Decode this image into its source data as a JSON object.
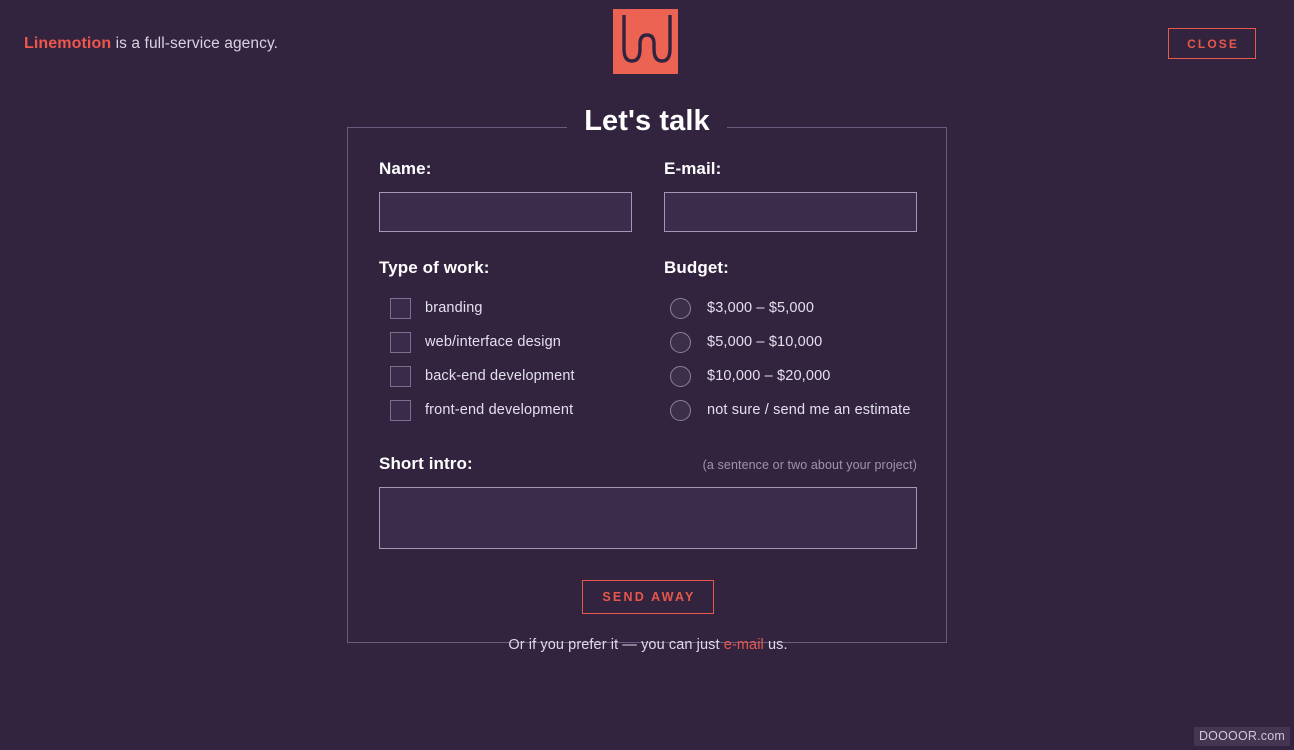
{
  "header": {
    "brand": "Linemotion",
    "tagline_rest": " is a full-service agency.",
    "logo_icon": "linemotion-monogram-icon",
    "close_label": "CLOSE"
  },
  "form": {
    "title": "Let's talk",
    "name": {
      "label": "Name:",
      "value": "",
      "placeholder": ""
    },
    "email": {
      "label": "E-mail:",
      "value": "",
      "placeholder": ""
    },
    "type_of_work": {
      "label": "Type of work:",
      "options": [
        {
          "label": "branding",
          "checked": false
        },
        {
          "label": "web/interface design",
          "checked": false
        },
        {
          "label": "back-end development",
          "checked": false
        },
        {
          "label": "front-end development",
          "checked": false
        }
      ]
    },
    "budget": {
      "label": "Budget:",
      "options": [
        {
          "label": "$3,000 – $5,000",
          "checked": false
        },
        {
          "label": "$5,000 – $10,000",
          "checked": false
        },
        {
          "label": "$10,000 – $20,000",
          "checked": false
        },
        {
          "label": "not sure / send me an estimate",
          "checked": false
        }
      ]
    },
    "short_intro": {
      "label": "Short intro:",
      "hint": "(a sentence or two about your project)",
      "value": "",
      "placeholder": ""
    },
    "submit_label": "SEND AWAY",
    "footnote": {
      "prefix": "Or if you prefer it — you can just ",
      "link": "e-mail",
      "suffix": " us."
    }
  },
  "watermark": "DOOOOR.com",
  "colors": {
    "background": "#32243f",
    "accent": "#e8574c",
    "logo_fill": "#ec6354",
    "panel_border": "#6b5b80",
    "input_border": "#a298b5",
    "input_fill": "#3b2c4c",
    "text": "#e4dfee",
    "muted": "#9f92b2"
  }
}
